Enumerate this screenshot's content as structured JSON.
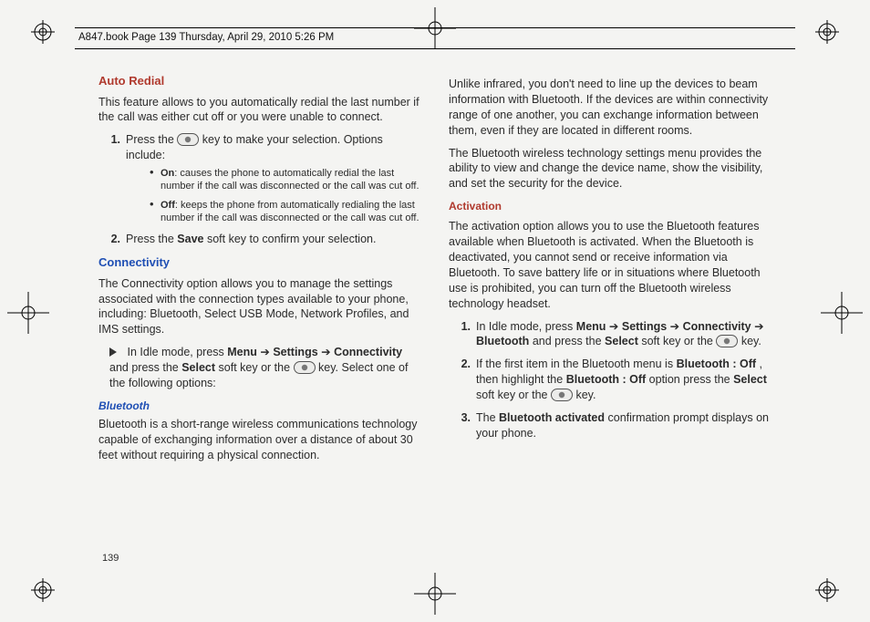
{
  "header": {
    "text": "A847.book  Page 139  Thursday, April 29, 2010  5:26 PM"
  },
  "pageNumber": "139",
  "left": {
    "autoRedial": {
      "heading": "Auto Redial",
      "intro": "This feature allows to you automatically redial the last number if the call was either cut off or you were unable to connect.",
      "steps": {
        "s1_a": "Press the ",
        "s1_b": " key to make your selection. Options include:",
        "opt1_label": "On",
        "opt1_text": ": causes the phone to automatically redial the last number if the call was disconnected or the call was cut off.",
        "opt2_label": "Off",
        "opt2_text": ": keeps the phone from automatically redialing the last number if the call was disconnected or the call was cut off.",
        "s2_a": "Press the ",
        "s2_b": "Save",
        "s2_c": " soft key to confirm your selection."
      }
    },
    "connectivity": {
      "heading": "Connectivity",
      "intro": "The Connectivity option allows you to manage the settings associated with the connection types available to your phone, including: Bluetooth, Select USB Mode, Network Profiles, and IMS settings.",
      "idle_a": "In Idle mode, press ",
      "idle_b": "Menu",
      "idle_c": "Settings",
      "idle_d": "Connectivity",
      "idle_e": " and press the ",
      "idle_f": "Select",
      "idle_g": " soft key or the ",
      "idle_h": " key. Select one of the following options:"
    },
    "bluetooth": {
      "heading": "Bluetooth",
      "p1": "Bluetooth is a short-range wireless communications technology capable of exchanging information over a distance of about 30 feet without requiring a physical connection."
    }
  },
  "right": {
    "bt_p1": "Unlike infrared, you don't need to line up the devices to beam information with Bluetooth. If the devices are within connectivity range of one another, you can exchange information between them, even if they are located in different rooms.",
    "bt_p2": "The Bluetooth wireless technology settings menu provides the ability to view and change the device name, show the visibility, and set the security for the device.",
    "activation": {
      "heading": "Activation",
      "intro": "The activation option allows you to use the Bluetooth features available when Bluetooth is activated. When the Bluetooth is deactivated, you cannot send or receive information via Bluetooth. To save battery life or in situations where Bluetooth use is prohibited, you can turn off the Bluetooth wireless technology headset.",
      "s1_a": "In Idle mode, press ",
      "s1_menu": "Menu",
      "s1_settings": "Settings",
      "s1_conn": "Connectivity",
      "s1_bt": "Bluetooth",
      "s1_b": " and press the ",
      "s1_select": "Select",
      "s1_c": " soft key or the ",
      "s1_d": " key.",
      "s2_a": "If the first item in the Bluetooth menu is ",
      "s2_btoff": "Bluetooth : Off",
      "s2_b": ", then highlight the ",
      "s2_c": " option press the ",
      "s2_select": "Select",
      "s2_d": " soft key or the ",
      "s2_e": " key.",
      "s3_a": "The ",
      "s3_b": "Bluetooth activated",
      "s3_c": " confirmation prompt displays on your phone."
    }
  }
}
